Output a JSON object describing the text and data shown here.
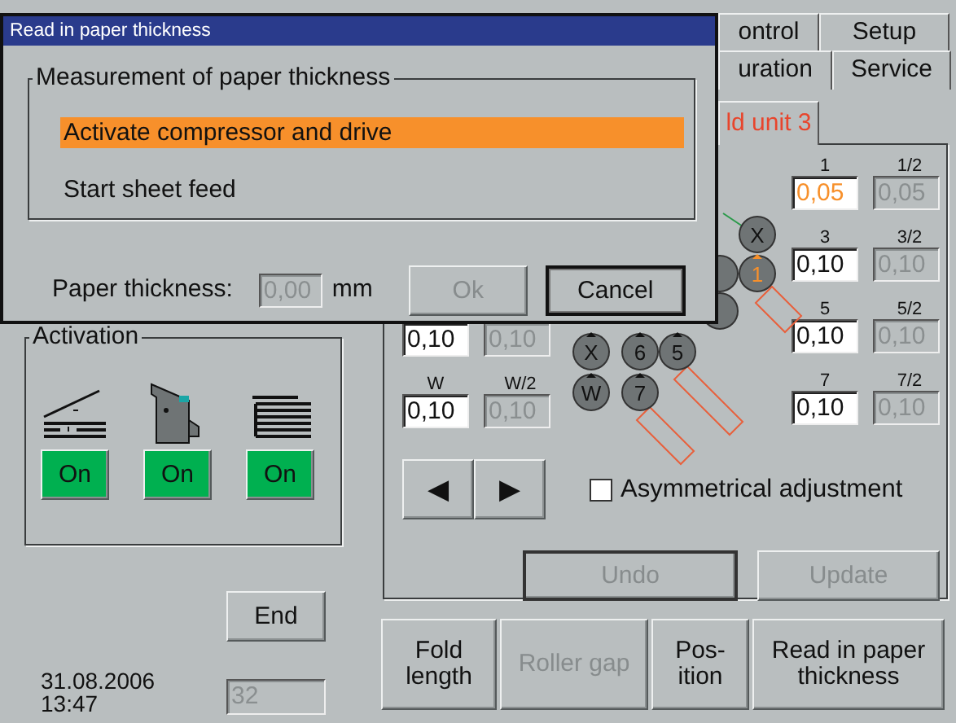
{
  "dialog": {
    "title": "Read in paper thickness",
    "group_title": "Measurement of paper thickness",
    "options": [
      {
        "text": "Activate compressor and drive",
        "selected": true
      },
      {
        "text": "Start sheet feed",
        "selected": false
      }
    ],
    "thickness_label": "Paper thickness:",
    "thickness_value": "0,00",
    "thickness_disabled": true,
    "unit": "mm",
    "buttons": [
      {
        "label": "Ok",
        "disabled": true
      },
      {
        "label": "Cancel",
        "disabled": false
      }
    ]
  },
  "tabs": [
    [
      {
        "label": "ontrol"
      },
      {
        "label": "Setup"
      }
    ],
    [
      {
        "label": "uration"
      },
      {
        "label": "Service"
      }
    ]
  ],
  "unit_tab": {
    "label": "ld unit 3",
    "selected": true
  },
  "left_fields": [
    {
      "main": {
        "value": "0,10",
        "disabled": false
      },
      "half": {
        "value": "0,10",
        "disabled": true
      }
    },
    {
      "main": {
        "label": "W",
        "value": "0,10",
        "disabled": false
      },
      "half": {
        "label": "W/2",
        "value": "0,10",
        "disabled": true
      }
    }
  ],
  "right_fields": [
    {
      "main": {
        "label": "1",
        "value": "0,05",
        "disabled": false,
        "changed": true
      },
      "half": {
        "label": "1/2",
        "value": "0,05",
        "disabled": true
      }
    },
    {
      "main": {
        "label": "3",
        "value": "0,10",
        "disabled": false,
        "changed": false
      },
      "half": {
        "label": "3/2",
        "value": "0,10",
        "disabled": true
      }
    },
    {
      "main": {
        "label": "5",
        "value": "0,10",
        "disabled": false,
        "changed": false
      },
      "half": {
        "label": "5/2",
        "value": "0,10",
        "disabled": true
      }
    },
    {
      "main": {
        "label": "7",
        "value": "0,10",
        "disabled": false,
        "changed": false
      },
      "half": {
        "label": "7/2",
        "value": "0,10",
        "disabled": true
      }
    }
  ],
  "rollers": [
    {
      "label": "X",
      "active": false
    },
    {
      "label": "1",
      "active": true
    },
    {
      "label": "X",
      "active": false
    },
    {
      "label": "6",
      "active": false
    },
    {
      "label": "5",
      "active": false
    },
    {
      "label": "W",
      "active": false
    },
    {
      "label": "7",
      "active": false
    }
  ],
  "arrows": [
    "◀",
    "▶"
  ],
  "asymmetrical": {
    "label": "Asymmetrical adjustment",
    "checked": false
  },
  "panel_buttons": [
    {
      "label": "Undo",
      "disabled": true
    },
    {
      "label": "Update",
      "disabled": true
    }
  ],
  "function_buttons": [
    {
      "label": "Fold length",
      "disabled": false
    },
    {
      "label": "Roller gap",
      "disabled": true
    },
    {
      "label": "Pos-ition",
      "disabled": false
    },
    {
      "label": "Read in paper thickness",
      "disabled": false
    }
  ],
  "activation": {
    "title": "Activation",
    "units": [
      {
        "button": "On",
        "on": true
      },
      {
        "button": "On",
        "on": true
      },
      {
        "button": "On",
        "on": true
      }
    ]
  },
  "end_button": "End",
  "date": "31.08.2006",
  "time": "13:47",
  "counter": {
    "value": "32",
    "disabled": true
  }
}
